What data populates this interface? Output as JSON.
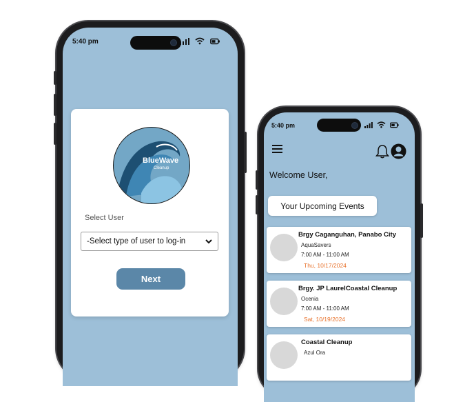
{
  "login_phone": {
    "status_time": "5:40 pm",
    "logo": {
      "title": "BlueWave",
      "subtitle": "Cleanup"
    },
    "select_label": "Select User",
    "select_value": "-Select type of user to log-in",
    "next_label": "Next"
  },
  "home_phone": {
    "status_time": "5:40 pm",
    "welcome": "Welcome User,",
    "events_title": "Your Upcoming Events",
    "events": [
      {
        "title": "Brgy Caganguhan, Panabo City",
        "org": "AquaSavers",
        "time": "7:00 AM - 11:00 AM",
        "date": "Thu, 10/17/2024"
      },
      {
        "title": "Brgy. JP LaurelCoastal Cleanup",
        "org": "Ocenia",
        "time": "7:00 AM - 11:00 AM",
        "date": "Sat, 10/19/2024"
      },
      {
        "title": "Coastal Cleanup",
        "org": "Azul Ora",
        "time": "",
        "date": ""
      }
    ]
  },
  "colors": {
    "screen_bg": "#9dbfd8",
    "button": "#5b87a8",
    "date_accent": "#e8722c"
  }
}
